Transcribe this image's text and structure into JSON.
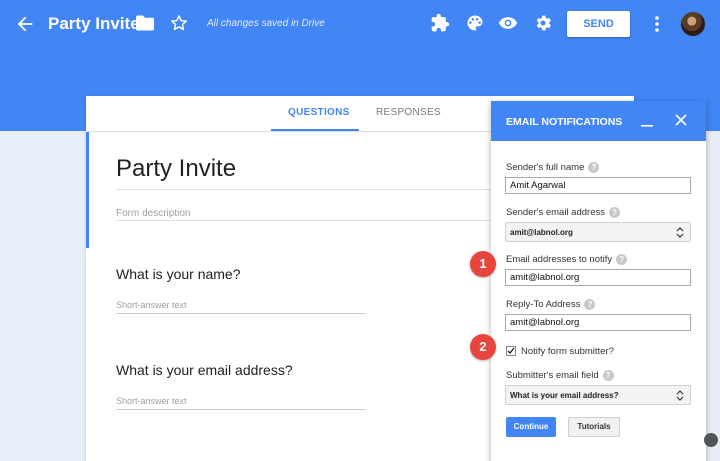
{
  "header": {
    "title": "Party Invite",
    "saved_status": "All changes saved in Drive",
    "send_label": "SEND",
    "icons": [
      "back-arrow-icon",
      "folder-icon",
      "star-icon",
      "puzzle-icon",
      "palette-icon",
      "eye-icon",
      "gear-icon",
      "kebab-menu-icon"
    ],
    "accent_color": "#4285f4"
  },
  "form": {
    "tabs": [
      {
        "label": "QUESTIONS",
        "active": true
      },
      {
        "label": "RESPONSES",
        "active": false
      }
    ],
    "title": "Party Invite",
    "description_placeholder": "Form description",
    "questions": [
      {
        "title": "What is your name?",
        "hint": "Short-answer text"
      },
      {
        "title": "What is your email address?",
        "hint": "Short-answer text"
      }
    ]
  },
  "email_panel": {
    "title": "EMAIL NOTIFICATIONS",
    "sender_name_label": "Sender's full name",
    "sender_name_value": "Amit Agarwal",
    "sender_email_label": "Sender's email address",
    "sender_email_value": "amit@labnol.org",
    "notify_label": "Email addresses to notify",
    "notify_value": "amit@labnol.org",
    "reply_to_label": "Reply-To Address",
    "reply_to_value": "amit@labnol.org",
    "notify_submitter_label": "Notify form submitter?",
    "notify_submitter_checked": true,
    "submitter_field_label": "Submitter's email field",
    "submitter_field_value": "What is your email address?",
    "help_glyph": "?",
    "continue_label": "Continue",
    "tutorials_label": "Tutorials"
  },
  "annotations": {
    "step_1": "1",
    "step_2": "2",
    "marker_color": "#e8463d"
  }
}
